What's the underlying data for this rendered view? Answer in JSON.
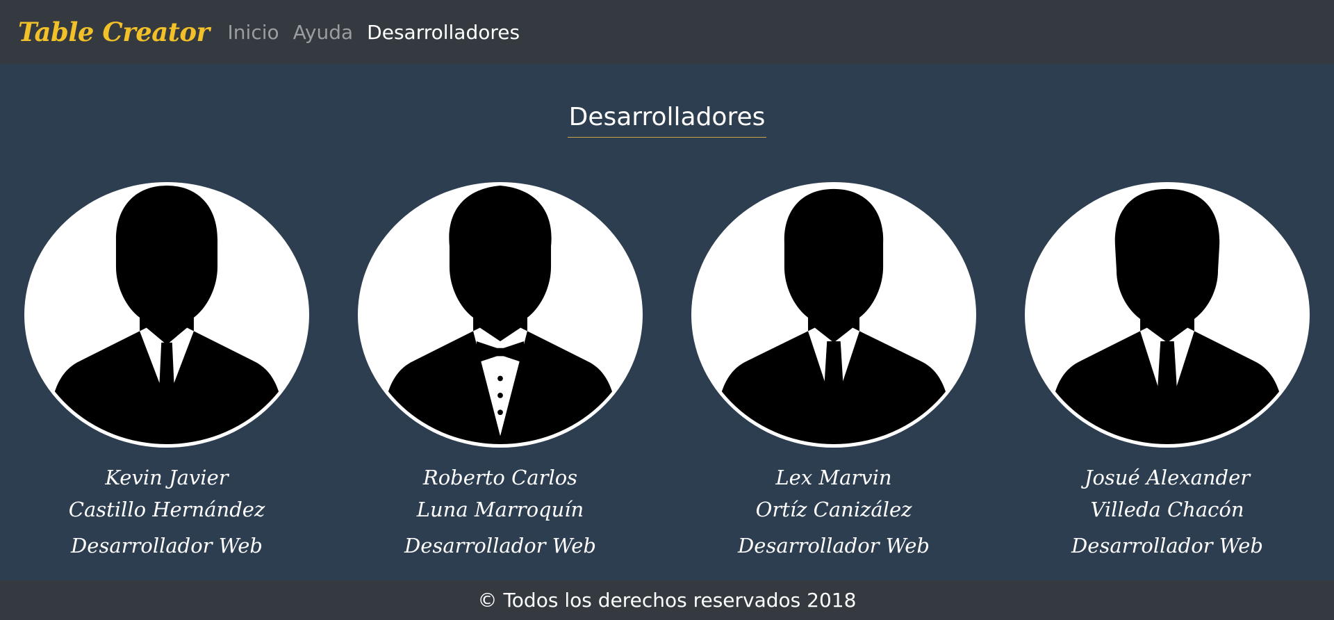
{
  "navbar": {
    "brand": "Table Creator",
    "links": [
      {
        "label": "Inicio"
      },
      {
        "label": "Ayuda"
      },
      {
        "label": "Desarrolladores"
      }
    ]
  },
  "section": {
    "title": "Desarrolladores"
  },
  "developers": [
    {
      "first": "Kevin Javier",
      "last": "Castillo Hernández",
      "role": "Desarrollador Web",
      "attire": "tie"
    },
    {
      "first": "Roberto Carlos",
      "last": "Luna Marroquín",
      "role": "Desarrollador Web",
      "attire": "bowtie"
    },
    {
      "first": "Lex Marvin",
      "last": "Ortíz Canizález",
      "role": "Desarrollador Web",
      "attire": "tie"
    },
    {
      "first": "Josué Alexander",
      "last": "Villeda Chacón",
      "role": "Desarrollador Web",
      "attire": "tie"
    }
  ],
  "footer": {
    "text": "© Todos los derechos reservados 2018"
  },
  "colors": {
    "brand": "#f2c029",
    "background": "#2d3e50",
    "navbar": "#343a40"
  }
}
